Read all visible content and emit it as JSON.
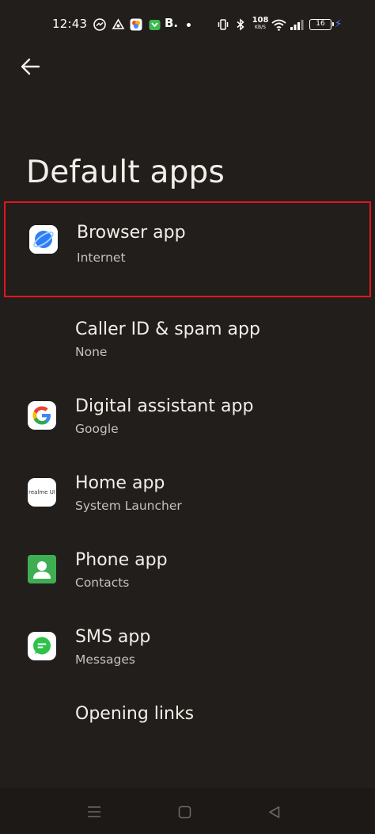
{
  "status_bar": {
    "time": "12:43",
    "letter_icon": "B.",
    "net_speed_value": "108",
    "net_speed_unit": "KB/S",
    "battery_level": "16",
    "icons": [
      "messenger-icon",
      "share-icon",
      "photos-icon",
      "vpn-icon",
      "vibrate-icon",
      "bluetooth-icon",
      "wifi-icon",
      "signal-icon",
      "battery-icon",
      "charging-icon"
    ]
  },
  "header": {
    "back_icon": "back-arrow-icon",
    "title": "Default apps"
  },
  "items": [
    {
      "label": "Browser app",
      "subtitle": "Internet",
      "icon": "internet-browser-icon",
      "highlighted": true
    },
    {
      "label": "Caller ID & spam app",
      "subtitle": "None",
      "icon": null,
      "highlighted": false
    },
    {
      "label": "Digital assistant app",
      "subtitle": "Google",
      "icon": "google-icon",
      "highlighted": false
    },
    {
      "label": "Home app",
      "subtitle": "System Launcher",
      "icon": "realme-ui-icon",
      "icon_text": "realme UI",
      "highlighted": false
    },
    {
      "label": "Phone app",
      "subtitle": "Contacts",
      "icon": "contacts-icon",
      "highlighted": false
    },
    {
      "label": "SMS app",
      "subtitle": "Messages",
      "icon": "messages-icon",
      "highlighted": false
    },
    {
      "label": "Opening links",
      "subtitle": "",
      "icon": null,
      "highlighted": false
    }
  ],
  "nav_bar": {
    "buttons": [
      "recents-menu-icon",
      "home-square-icon",
      "back-triangle-icon"
    ]
  },
  "colors": {
    "background": "#221e1c",
    "highlight_border": "#e0161f",
    "text_primary": "#f4eee8",
    "text_secondary": "#c8c1ba",
    "charging_accent": "#4a7cff"
  }
}
